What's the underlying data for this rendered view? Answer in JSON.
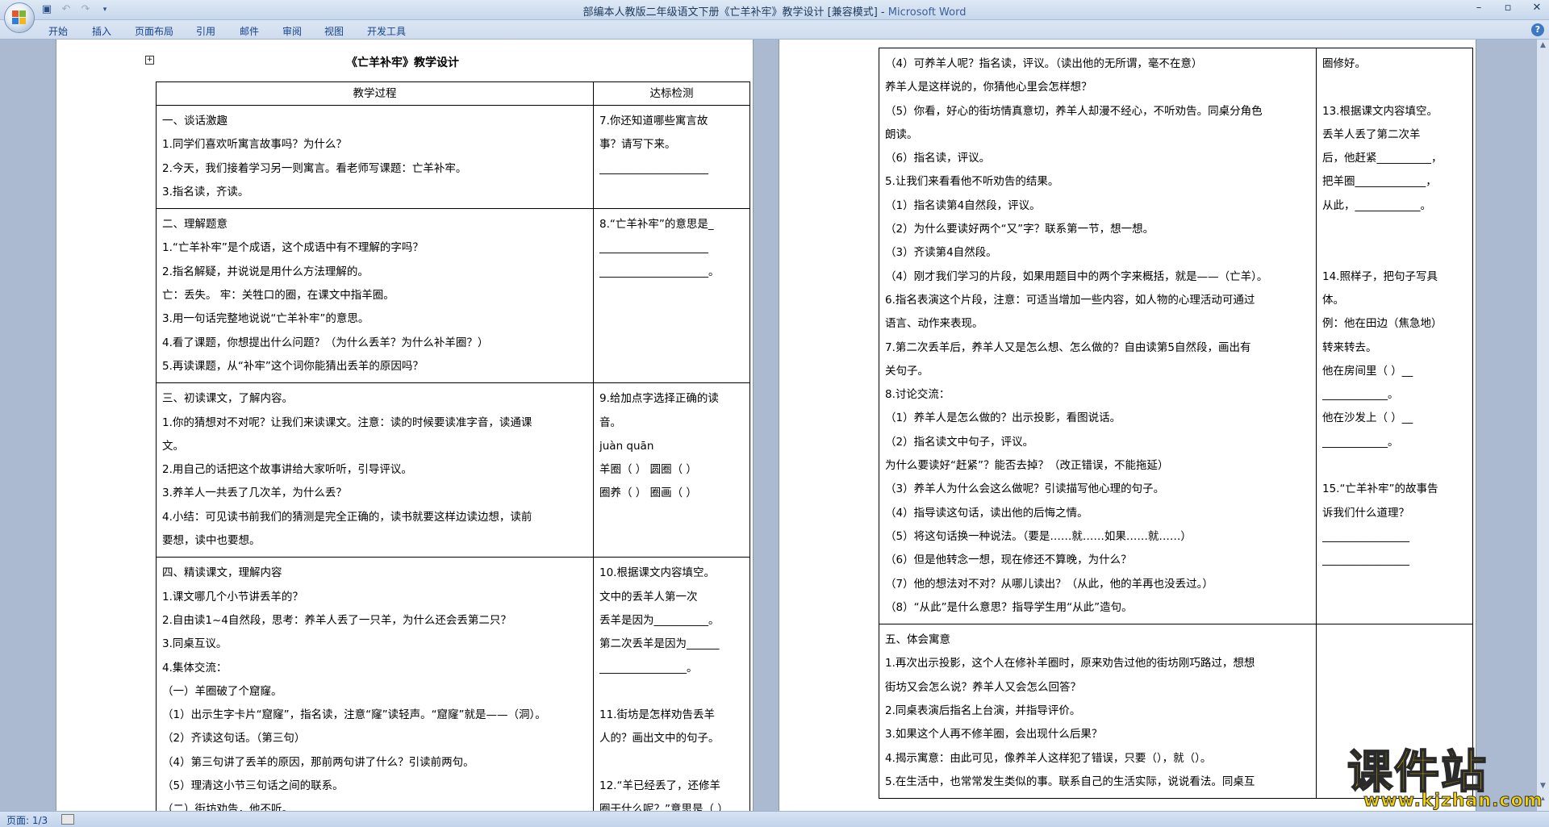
{
  "window": {
    "title": "部编本人教版二年级语文下册《亡羊补牢》教学设计 [兼容模式]",
    "app_name": "Microsoft Word",
    "separator": " - "
  },
  "ribbon": {
    "tabs": [
      "开始",
      "插入",
      "页面布局",
      "引用",
      "邮件",
      "审阅",
      "视图",
      "开发工具"
    ]
  },
  "status": {
    "page": "页面: 1/3"
  },
  "watermark": {
    "big": "课件站",
    "small": "www.kjzhan.com"
  },
  "page1": {
    "title": "《亡羊补牢》教学设计",
    "headers": [
      "教学过程",
      "达标检测"
    ],
    "rows": [
      {
        "left": [
          "一、谈话激趣",
          "1.同学们喜欢听寓言故事吗？为什么？",
          "2.今天，我们接着学习另一则寓言。看老师写课题：亡羊补牢。",
          "3.指名读，齐读。"
        ],
        "right": [
          "7.你还知道哪些寓言故",
          "事？请写下来。",
          "____________________"
        ]
      },
      {
        "left": [
          "二、理解题意",
          "1.“亡羊补牢”是个成语，这个成语中有不理解的字吗？",
          "2.指名解疑，并说说是用什么方法理解的。",
          "亡：丢失。    牢：关牲口的圈，在课文中指羊圈。",
          "3.用一句话完整地说说“亡羊补牢”的意思。",
          "4.看了课题，你想提出什么问题？（为什么丢羊？为什么补羊圈？）",
          "5.再读课题，从“补牢”这个词你能猜出丢羊的原因吗？"
        ],
        "right": [
          "8.“亡羊补牢”的意思是_",
          "____________________",
          "____________________。",
          ""
        ]
      },
      {
        "left": [
          "三、初读课文，了解内容。",
          "1.你的猜想对不对呢？让我们来读课文。注意：读的时候要读准字音，读通课",
          "文。",
          "2.用自己的话把这个故事讲给大家听听，引导评议。",
          "3.养羊人一共丢了几次羊，为什么丢？",
          "4.小结：可见读书前我们的猜测是完全正确的，读书就要这样边读边想，读前",
          "要想，读中也要想。"
        ],
        "right": [
          "9.给加点字选择正确的读",
          "音。",
          "juàn   quān",
          "羊圈（   ）  圆圈（   ）",
          "圈养（   ）  圈画（   ）",
          "",
          ""
        ]
      },
      {
        "left": [
          "四、精读课文，理解内容",
          "1.课文哪几个小节讲丢羊的？",
          "2.自由读1~4自然段，思考：养羊人丢了一只羊，为什么还会丢第二只？",
          "3.同桌互议。",
          "4.集体交流：",
          "（一）羊圈破了个窟窿。",
          "（1）出示生字卡片“窟窿”，指名读，注意“窿”读轻声。“窟窿”就是——（洞）。",
          "（2）齐读这句话。（第三句）",
          "（4）第三句讲了丢羊的原因，那前两句讲了什么？引读前两句。",
          "（5）理清这小节三句话之间的联系。",
          "（二）街坊劝告，他不听。"
        ],
        "right": [
          "10.根据课文内容填空。",
          "   文中的丢羊人第一次",
          "丢羊是因为__________。",
          "第二次丢羊是因为______",
          "________________。",
          "",
          "11.街坊是怎样劝告丢羊",
          "人的？画出文中的句子。",
          "",
          "12.“羊已经丢了，还修羊",
          "圈干什么呢？”意思是（  ）"
        ]
      }
    ]
  },
  "page2": {
    "rows": [
      {
        "left": [
          "（4）可养羊人呢？指名读，评议。（读出他的无所谓，毫不在意）",
          "养羊人是这样说的，你猜他心里会怎样想？",
          "（5）你看，好心的街坊情真意切，养羊人却漫不经心，不听劝告。同桌分角色",
          "朗读。",
          "（6）指名读，评议。",
          "5.让我们来看看他不听劝告的结果。",
          "（1）指名读第4自然段，评议。",
          "（2）为什么要读好两个“又”字？联系第一节，想一想。",
          "（3）齐读第4自然段。",
          "（4）刚才我们学习的片段，如果用题目中的两个字来概括，就是——（亡羊）。",
          "6.指名表演这个片段，注意：可适当增加一些内容，如人物的心理活动可通过",
          "语言、动作来表现。",
          "7.第二次丢羊后，养羊人又是怎么想、怎么做的？自由读第5自然段，画出有",
          "关句子。",
          "8.讨论交流：",
          "（1）养羊人是怎么做的？出示投影，看图说话。",
          "（2）指名读文中句子，评议。",
          "为什么要读好“赶紧”？能否去掉？（改正错误，不能拖延）",
          "（3）养羊人为什么会这么做呢？引读描写他心理的句子。",
          "（4）指导读这句话，读出他的后悔之情。",
          "（5）将这句话换一种说法。（要是……就……如果……就……）",
          "（6）但是他转念一想，现在修还不算晚，为什么？",
          "（7）他的想法对不对？从哪儿读出？（从此，他的羊再也没丢过。）",
          "（8）“从此”是什么意思？指导学生用“从此”造句。"
        ],
        "right": [
          "圈修好。",
          "",
          "13.根据课文内容填空。",
          "   丢羊人丢了第二次羊",
          "后，他赶紧__________，",
          "把羊圈_____________，",
          "从此，____________。",
          "",
          "",
          "14.照样子，把句子写具",
          "体。",
          "例：他在田边（焦急地）",
          "转来转去。",
          "他在房间里（      ）__",
          "____________。",
          "他在沙发上（      ）__",
          "____________。",
          "",
          "15.“亡羊补牢”的故事告",
          "诉我们什么道理？",
          "________________",
          "________________",
          "",
          ""
        ]
      },
      {
        "left": [
          "五、体会寓意",
          "1.再次出示投影，这个人在修补羊圈时，原来劝告过他的街坊刚巧路过，想想",
          "街坊又会怎么说？养羊人又会怎么回答？",
          "2.同桌表演后指名上台演，并指导评价。",
          "3.如果这个人再不修羊圈，会出现什么后果？",
          "4.揭示寓意：由此可见，像养羊人这样犯了错误，只要（），就（）。",
          "5.在生活中，也常常发生类似的事。联系自己的生活实际，说说看法。同桌互"
        ],
        "right": [
          ""
        ]
      }
    ]
  }
}
